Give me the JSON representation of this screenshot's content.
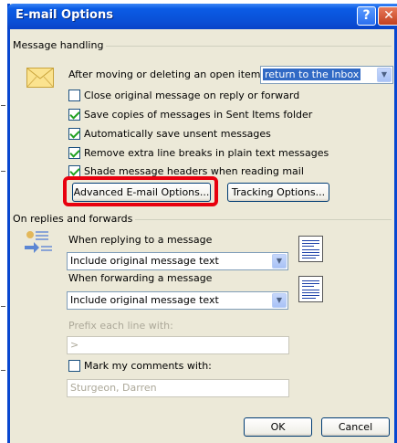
{
  "window": {
    "title": "E-mail Options"
  },
  "message_handling": {
    "group_label": "Message handling",
    "after_moving_label": "After moving or deleting an open item:",
    "after_moving_value": "return to the Inbox",
    "checkboxes": [
      {
        "label": "Close original message on reply or forward",
        "checked": false
      },
      {
        "label": "Save copies of messages in Sent Items folder",
        "checked": true
      },
      {
        "label": "Automatically save unsent messages",
        "checked": true
      },
      {
        "label": "Remove extra line breaks in plain text messages",
        "checked": true
      },
      {
        "label": "Shade message headers when reading mail",
        "checked": true
      }
    ],
    "advanced_button": "Advanced E-mail Options...",
    "tracking_button": "Tracking Options..."
  },
  "replies_forwards": {
    "group_label": "On replies and forwards",
    "replying_label": "When replying to a message",
    "replying_value": "Include original message text",
    "forwarding_label": "When forwarding a message",
    "forwarding_value": "Include original message text",
    "prefix_label": "Prefix each line with:",
    "prefix_value": ">",
    "mark_comments_label": "Mark my comments with:",
    "mark_comments_checked": false,
    "mark_comments_value": "Sturgeon, Darren"
  },
  "buttons": {
    "ok": "OK",
    "cancel": "Cancel"
  },
  "colors": {
    "highlight": "#e8000e",
    "title_bar": "#0a4fd6"
  }
}
